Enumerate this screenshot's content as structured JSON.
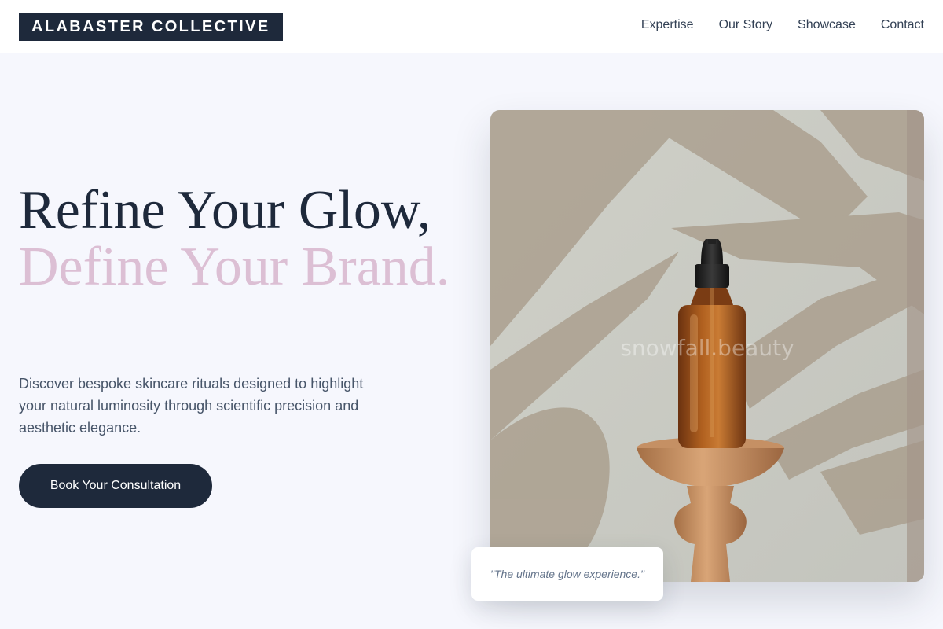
{
  "header": {
    "logo": "ALABASTER COLLECTIVE",
    "nav": [
      "Expertise",
      "Our Story",
      "Showcase",
      "Contact"
    ]
  },
  "hero": {
    "headline_line1": "Refine Your Glow,",
    "headline_line2": "Define Your Brand.",
    "description": "Discover bespoke skincare rituals designed to highlight your natural luminosity through scientific precision and aesthetic elegance.",
    "cta_label": "Book Your Consultation"
  },
  "image": {
    "watermark": "snowfall.beauty",
    "subject": "amber dropper bottle on wooden pedestal with leaf shadows"
  },
  "quote": "\"The ultimate glow experience.\"",
  "colors": {
    "primary": "#1e293b",
    "accent_pink": "#dcbfd4",
    "background": "#f6f7fd"
  }
}
